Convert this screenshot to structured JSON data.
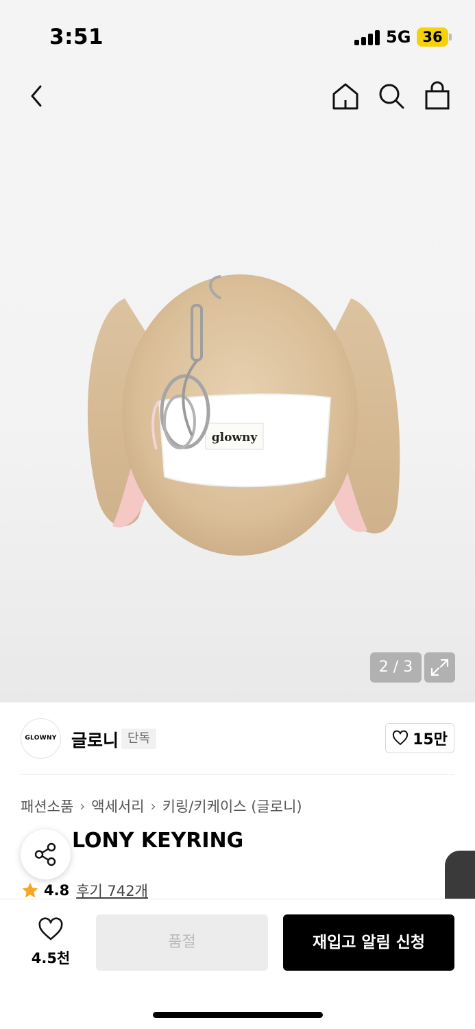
{
  "status": {
    "time": "3:51",
    "network": "5G",
    "battery": "36"
  },
  "nav": {
    "back_icon": "chevron-left-icon",
    "home_icon": "home-icon",
    "search_icon": "search-icon",
    "bag_icon": "shopping-bag-icon"
  },
  "gallery": {
    "counter": "2 / 3",
    "expand_icon": "expand-icon"
  },
  "brand": {
    "logo_text": "GLOWNY",
    "name": "글로니",
    "badge": "단독",
    "likes": "15만"
  },
  "breadcrumb": [
    "패션소품",
    "액세서리",
    "키링/키케이스 (글로니)"
  ],
  "product": {
    "title": "LONY KEYRING",
    "rating": "4.8",
    "reviews": "후기 742개"
  },
  "bottom": {
    "wish_count": "4.5천",
    "soldout_label": "품절",
    "restock_label": "재입고 알림 신청"
  },
  "colors": {
    "accent": "#000000",
    "battery": "#f5d20a",
    "star": "#f5a623"
  }
}
